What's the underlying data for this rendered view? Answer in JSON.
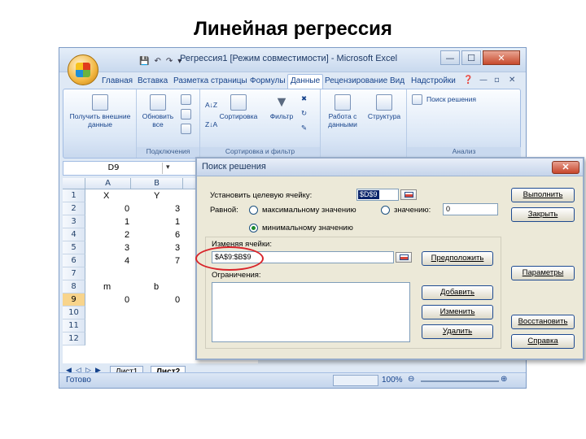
{
  "slide": {
    "title": "Линейная регрессия"
  },
  "window": {
    "title": "Регрессия1  [Режим совместимости]  -  Microsoft Excel"
  },
  "ribbon": {
    "tabs": [
      "Главная",
      "Вставка",
      "Разметка страницы",
      "Формулы",
      "Данные",
      "Рецензирование",
      "Вид",
      "Надстройки"
    ],
    "active_tab": "Данные",
    "groups": {
      "external": {
        "label": "Получить внешние данные"
      },
      "connections": {
        "label": "Подключения",
        "refresh": "Обновить все"
      },
      "sortfilter": {
        "label": "Сортировка и фильтр",
        "sort": "Сортировка",
        "filter": "Фильтр"
      },
      "tools": {
        "text_to_columns": "Работа с данными",
        "outline": "Структура"
      },
      "analysis": {
        "label": "Анализ",
        "solver": "Поиск решения"
      }
    }
  },
  "formula_bar": {
    "name_box": "D9"
  },
  "sheet": {
    "columns": [
      "A",
      "B"
    ],
    "rows": [
      "1",
      "2",
      "3",
      "4",
      "5",
      "6",
      "7",
      "8",
      "9",
      "10",
      "11",
      "12"
    ],
    "selected_row": "9",
    "cells": {
      "a1": "X",
      "b1": "Y",
      "a2": "0",
      "b2": "3",
      "a3": "1",
      "b3": "1",
      "a4": "2",
      "b4": "6",
      "a5": "3",
      "b5": "3",
      "a6": "4",
      "b6": "7",
      "a8": "m",
      "b8": "b",
      "a9": "0",
      "b9": "0"
    },
    "tabs": [
      "Лист1",
      "Лист2"
    ],
    "active_tab": "Лист2"
  },
  "status": {
    "ready": "Готово",
    "zoom": "100%"
  },
  "dialog": {
    "title": "Поиск решения",
    "target_label": "Установить целевую ячейку:",
    "target_value": "$D$9",
    "equal_label": "Равной:",
    "opt_max": "максимальному значению",
    "opt_value": "значению:",
    "value_field": "0",
    "opt_min": "минимальному значению",
    "changing_label": "Изменяя ячейки:",
    "changing_value": "$A$9:$B$9",
    "constraints_label": "Ограничения:",
    "buttons": {
      "run": "Выполнить",
      "close": "Закрыть",
      "guess": "Предположить",
      "options": "Параметры",
      "add": "Добавить",
      "change": "Изменить",
      "reset": "Восстановить",
      "delete": "Удалить",
      "help": "Справка"
    }
  },
  "colors": {
    "highlight_circle": "#d8242a",
    "ribbon_text": "#15428b",
    "selection": "#0a246a"
  }
}
